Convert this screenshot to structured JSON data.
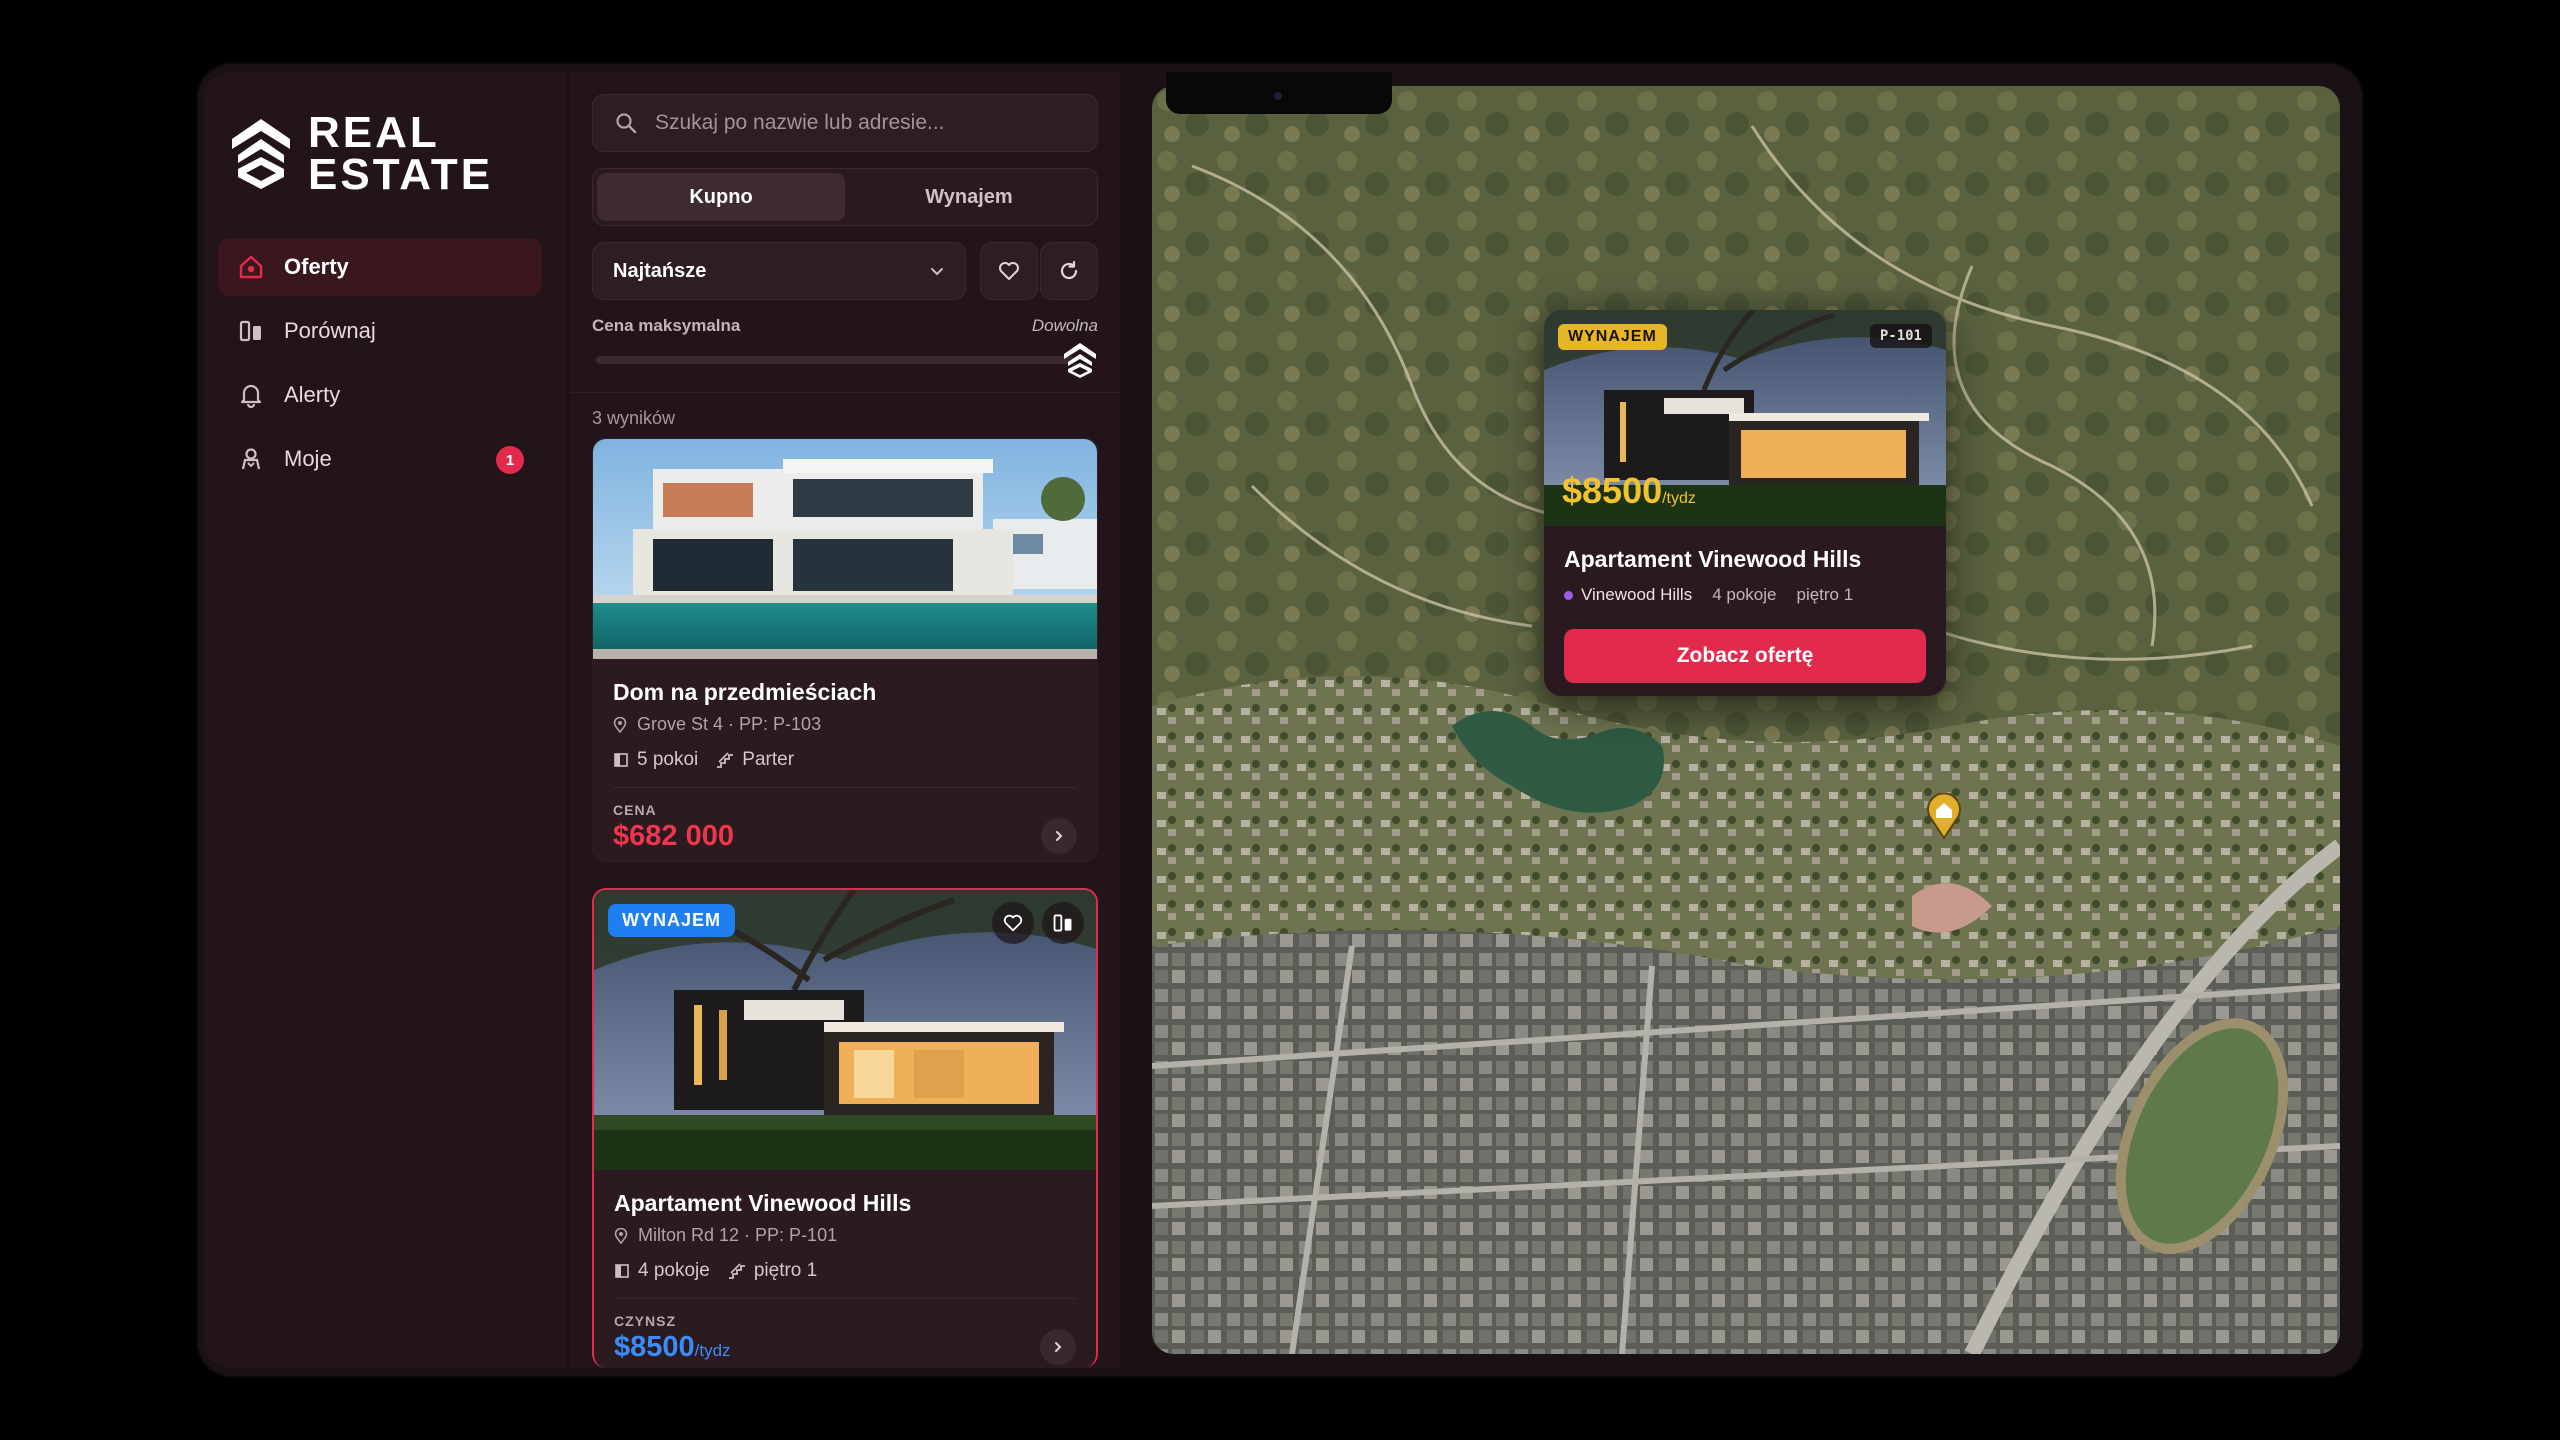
{
  "brand": {
    "line1": "REAL",
    "line2": "ESTATE"
  },
  "nav": [
    {
      "label": "Oferty",
      "icon": "home-icon",
      "active": true
    },
    {
      "label": "Porównaj",
      "icon": "compare-icon"
    },
    {
      "label": "Alerty",
      "icon": "bell-icon"
    },
    {
      "label": "Moje",
      "icon": "user-icon",
      "badge": "1"
    }
  ],
  "search": {
    "placeholder": "Szukaj po nazwie lub adresie..."
  },
  "mode_tabs": {
    "buy": "Kupno",
    "rent": "Wynajem",
    "active": "buy"
  },
  "sort": {
    "selected": "Najtańsze"
  },
  "price_filter": {
    "label": "Cena maksymalna",
    "value": "Dowolna",
    "level": 1.0
  },
  "results_count": "3 wyników",
  "listings": [
    {
      "title": "Dom na przedmieściach",
      "address": "Grove St 4 · PP: P-103",
      "rooms": "5 pokoi",
      "floor": "Parter",
      "price_caption": "CENA",
      "price": "$682 000",
      "price_suffix": ""
    },
    {
      "tag": "WYNAJEM",
      "title": "Apartament Vinewood Hills",
      "address": "Milton Rd 12 · PP: P-101",
      "rooms": "4 pokoje",
      "floor": "piętro 1",
      "price_caption": "CZYNSZ",
      "price": "$8500",
      "price_suffix": "/tydz"
    }
  ],
  "map_popup": {
    "tag": "WYNAJEM",
    "id": "P-101",
    "price": "$8500",
    "price_suffix": "/tydz",
    "title": "Apartament Vinewood Hills",
    "area": "Vinewood Hills",
    "rooms": "4 pokoje",
    "floor": "piętro 1",
    "cta": "Zobacz ofertę"
  },
  "colors": {
    "accent": "#e22a4d",
    "rent_blue": "#1f7ff2",
    "gold": "#f2c231",
    "panel": "#22141a"
  }
}
